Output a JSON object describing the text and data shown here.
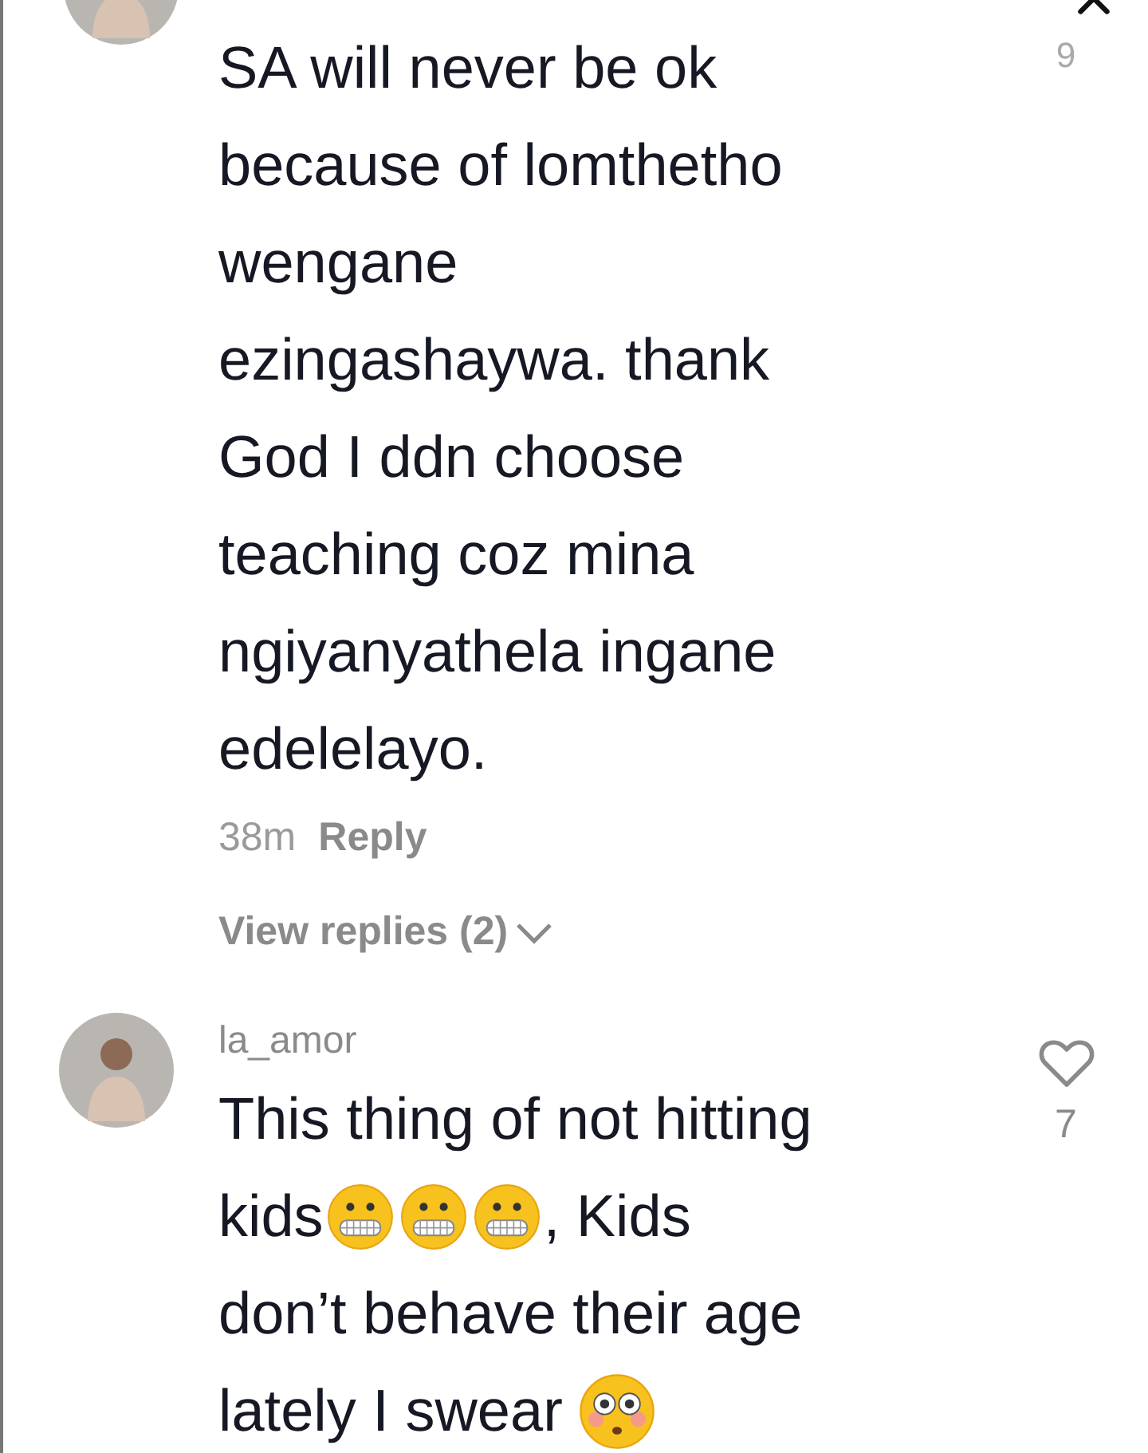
{
  "comments": [
    {
      "lines": [
        [
          {
            "kind": "text",
            "text": "SA will never be ok"
          }
        ],
        [
          {
            "kind": "text",
            "text": "because of lomthetho"
          }
        ],
        [
          {
            "kind": "text",
            "text": "wengane"
          }
        ],
        [
          {
            "kind": "text",
            "text": "ezingashaywa. thank"
          }
        ],
        [
          {
            "kind": "text",
            "text": "God I ddn choose"
          }
        ],
        [
          {
            "kind": "text",
            "text": "teaching coz mina"
          }
        ],
        [
          {
            "kind": "text",
            "text": "ngiyanyathela ingane"
          }
        ],
        [
          {
            "kind": "text",
            "text": "edelelayo."
          }
        ]
      ],
      "time": "38m",
      "reply": "Reply",
      "view_replies": "View replies (2)",
      "likes": "9"
    },
    {
      "username": "la_amor",
      "lines": [
        [
          {
            "kind": "text",
            "text": "This thing of not hitting"
          }
        ],
        [
          {
            "kind": "text",
            "text": "kids"
          },
          {
            "kind": "grimace"
          },
          {
            "kind": "grimace"
          },
          {
            "kind": "grimace"
          },
          {
            "kind": "text",
            "text": ", Kids"
          }
        ],
        [
          {
            "kind": "text",
            "text": "don’t behave their age"
          }
        ],
        [
          {
            "kind": "text",
            "text": "lately I swear"
          },
          {
            "kind": "flushed"
          }
        ]
      ],
      "likes": "7",
      "liked": false
    }
  ]
}
